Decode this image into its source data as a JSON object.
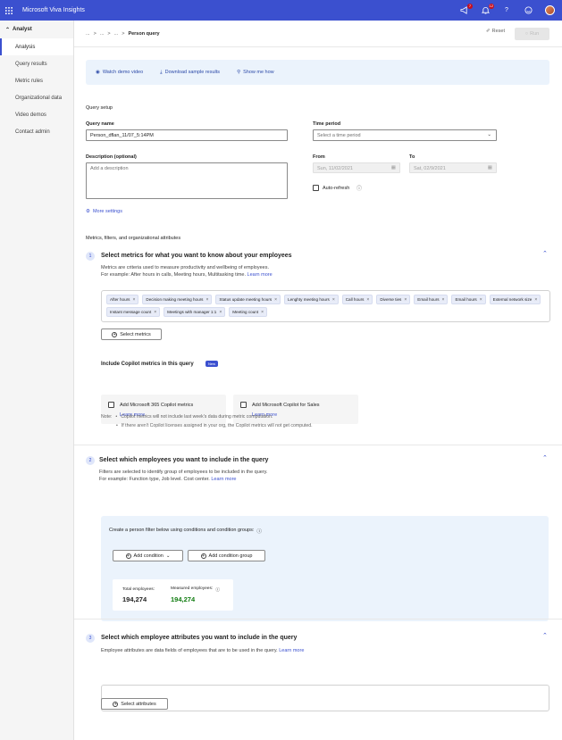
{
  "app": {
    "title": "Microsoft Viva Insights",
    "badges": {
      "announcements": "7",
      "notifications": "12"
    }
  },
  "sidebar": {
    "header": "Analyst",
    "items": [
      {
        "label": "Analysis"
      },
      {
        "label": "Query results"
      },
      {
        "label": "Metric rules"
      },
      {
        "label": "Organizational data"
      },
      {
        "label": "Video demos"
      },
      {
        "label": "Contact admin"
      }
    ]
  },
  "breadcrumb": {
    "ellipsis1": "...",
    "ellipsis2": "...",
    "ellipsis3": "...",
    "sep": ">",
    "current": "Person query"
  },
  "toolbar": {
    "reset_label": "Reset",
    "run_label": "Run"
  },
  "banner": {
    "demo_video": "Watch demo video",
    "download": "Download sample results",
    "show_me": "Show me how"
  },
  "query_setup": {
    "section_label": "Query setup",
    "name_label": "Query name",
    "name_value": "Person_dflan_11/07_5:14PM",
    "time_period_label": "Time period",
    "time_period_placeholder": "Select a time period",
    "description_label": "Description (optional)",
    "description_placeholder": "Add a description",
    "from_label": "From",
    "from_value": "Sun, 11/02/2021",
    "to_label": "To",
    "to_value": "Sat, 02/9/2021",
    "auto_refresh_label": "Auto-refresh",
    "more_settings": "More settings"
  },
  "metrics_section_label": "Metrics, filters, and organizational attributes",
  "section1": {
    "number": "1",
    "title": "Select metrics for what you want to know about your employees",
    "desc_line1": "Metrics are criteria used to measure productivity and wellbeing of employees.",
    "desc_line2": "For example: After hours in calls, Meeting hours, Multitasking time.",
    "learn_more": "Learn more",
    "chips": [
      "After hours",
      "Decision making meeting hours",
      "Status update meeting hours",
      "Lenghty meeting hours",
      "Call hours",
      "Diverse ties",
      "Email hours",
      "Email hours",
      "External network size",
      "Instant message count",
      "Meetings with manager 1:1",
      "Meeting count"
    ],
    "select_metrics_label": "Select metrics",
    "copilot_heading": "Include Copilot metrics in this query",
    "copilot_badge": "New",
    "copilot_card1_label": "Add Microsoft 365 Copilot metrics",
    "copilot_card1_link": "Learn more",
    "copilot_card2_label": "Add Microsoft Copilot for Sales",
    "copilot_card2_link": "Learn more",
    "note_label": "Note:",
    "note_line1": "Copilot metrics will not include last week's data during metric computation.",
    "note_line2": "If there aren't Copilot licenses assigned in your org, the Copilot metrics will not get computed."
  },
  "section2": {
    "number": "2",
    "title": "Select which employees you want to include in the query",
    "desc_line1": "Filters are selected to identify group of employees to be included in the query.",
    "desc_line2": "For example: Function type, Job level. Cost center.",
    "learn_more": "Learn more",
    "filter_instruction": "Create a person filter below using conditions and condition groups:",
    "add_condition_label": "Add condition",
    "add_condition_group_label": "Add condition group",
    "total_label": "Total employees:",
    "total_value": "194,274",
    "measured_label": "Measured employees:",
    "measured_value": "194,274"
  },
  "section3": {
    "number": "3",
    "title": "Select which employee attributes you want to include in the query",
    "desc_line1": "Employee attributes are data fields of employees that are to be used in the query.",
    "learn_more": "Learn more",
    "select_attributes_label": "Select attributes"
  },
  "colors": {
    "topbar": "#3b50cf",
    "accent": "#3b50cf",
    "measured": "#107c10",
    "badge": "#c50f1f"
  }
}
